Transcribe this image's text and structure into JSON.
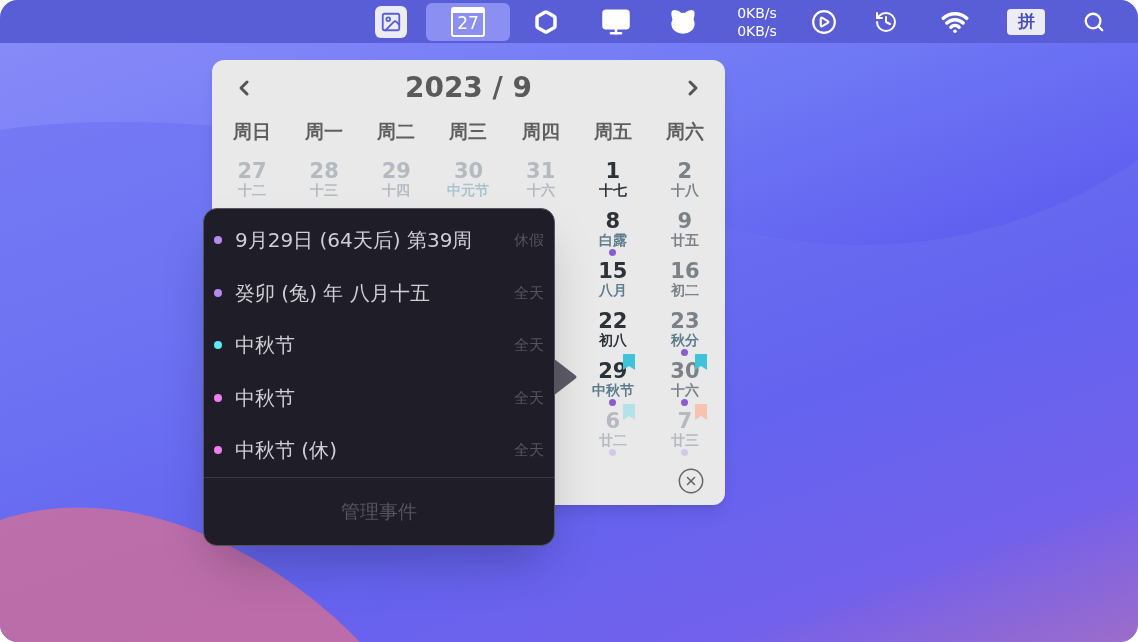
{
  "menu_bar": {
    "items": [
      {
        "kind": "photo",
        "selected": false
      },
      {
        "kind": "calendar",
        "label": "27",
        "selected": true
      },
      {
        "kind": "hexagon",
        "selected": false
      },
      {
        "kind": "monitor",
        "selected": false
      },
      {
        "kind": "cat",
        "selected": false
      },
      {
        "kind": "network",
        "lines": [
          "0KB/s",
          "0KB/s"
        ],
        "selected": false
      },
      {
        "kind": "play",
        "selected": false
      },
      {
        "kind": "history",
        "selected": false
      },
      {
        "kind": "wifi",
        "selected": false
      },
      {
        "kind": "input",
        "label": "拼",
        "selected": false
      },
      {
        "kind": "search",
        "selected": false
      }
    ]
  },
  "calendar": {
    "title": "2023 / 9",
    "weekdays": [
      "周日",
      "周一",
      "周二",
      "周三",
      "周四",
      "周五",
      "周六"
    ],
    "weeks": [
      {
        "cells": [
          {
            "day": "27",
            "lunar": "十二",
            "kind": "other",
            "special": false
          },
          {
            "day": "28",
            "lunar": "十三",
            "kind": "other",
            "special": false
          },
          {
            "day": "29",
            "lunar": "十四",
            "kind": "other",
            "special": false
          },
          {
            "day": "30",
            "lunar": "中元节",
            "kind": "other",
            "special": true
          },
          {
            "day": "31",
            "lunar": "十六",
            "kind": "other",
            "special": false
          },
          {
            "day": "1",
            "lunar": "十七",
            "kind": "current",
            "special": false
          },
          {
            "day": "2",
            "lunar": "十八",
            "kind": "weekend",
            "special": false
          }
        ]
      },
      {
        "cells": [
          {
            "day": "8",
            "lunar": "白露",
            "kind": "current",
            "special": true,
            "dot": {
              "color": "#8a5cd0"
            }
          },
          {
            "day": "9",
            "lunar": "廿五",
            "kind": "weekend",
            "special": false
          }
        ]
      },
      {
        "cells": [
          {
            "day": "15",
            "lunar": "八月",
            "kind": "current",
            "special": true
          },
          {
            "day": "16",
            "lunar": "初二",
            "kind": "weekend",
            "special": false
          }
        ]
      },
      {
        "cells": [
          {
            "day": "22",
            "lunar": "初八",
            "kind": "current",
            "special": false
          },
          {
            "day": "23",
            "lunar": "秋分",
            "kind": "weekend",
            "special": true,
            "dot": {
              "color": "#8a5cd0"
            }
          }
        ]
      },
      {
        "cells": [
          {
            "day": "29",
            "lunar": "中秋节",
            "kind": "current",
            "special": true,
            "dot": {
              "color": "#8a5cd0"
            },
            "ribbon": {
              "color": "#3ec3d8"
            }
          },
          {
            "day": "30",
            "lunar": "十六",
            "kind": "weekend",
            "special": false,
            "dot": {
              "color": "#8a5cd0"
            },
            "ribbon": {
              "color": "#3ec3d8"
            }
          }
        ]
      },
      {
        "cells": [
          {
            "day": "6",
            "lunar": "廿二",
            "kind": "other",
            "special": false,
            "dot": {
              "color": "#d4c8ea"
            },
            "ribbon": {
              "color": "#b4e2e8"
            }
          },
          {
            "day": "7",
            "lunar": "廿三",
            "kind": "other",
            "special": false,
            "dot": {
              "color": "#d4c8ea"
            },
            "ribbon": {
              "color": "#f5c3b2"
            }
          }
        ]
      }
    ]
  },
  "events_popover": {
    "events": [
      {
        "title": "9月29日 (64天后) 第39周",
        "time": "休假",
        "color": "#b48cf0"
      },
      {
        "title": "癸卯 (兔) 年 八月十五",
        "time": "全天",
        "color": "#b48cf0"
      },
      {
        "title": "中秋节",
        "time": "全天",
        "color": "#5ee8f4"
      },
      {
        "title": "中秋节",
        "time": "全天",
        "color": "#f07ef0"
      },
      {
        "title": "中秋节 (休)",
        "time": "全天",
        "color": "#f07ef0"
      }
    ],
    "footer": "管理事件"
  }
}
